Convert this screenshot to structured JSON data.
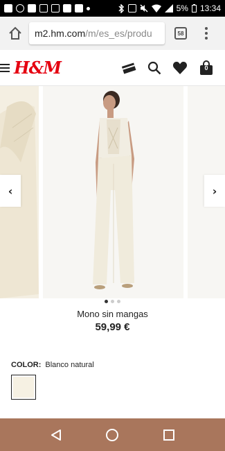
{
  "status_bar": {
    "battery_percent": "5%",
    "time": "13:34",
    "left_icons": [
      "facebook-icon",
      "whatsapp-icon",
      "app-icon",
      "check-icon",
      "mail-icon",
      "image-icon",
      "bag-notification-icon",
      "dot-icon"
    ],
    "right_icons": [
      "bluetooth-icon",
      "nfc-icon",
      "mute-icon",
      "wifi-icon",
      "signal-icon",
      "battery-icon"
    ]
  },
  "browser": {
    "url_host": "m2.hm.com",
    "url_path": "/m/es_es/produ",
    "tab_count": "58"
  },
  "header": {
    "logo": "H&M",
    "bag_count": "0",
    "icons": [
      "menu-icon",
      "card-icon",
      "search-icon",
      "heart-icon",
      "bag-icon"
    ]
  },
  "gallery": {
    "image_count": 3,
    "active_index": 0
  },
  "product": {
    "name": "Mono sin mangas",
    "price": "59,99 €"
  },
  "color": {
    "label": "COLOR:",
    "value": "Blanco natural",
    "swatch_hex": "#f6f1e3"
  },
  "colors": {
    "brand_red": "#e50010",
    "nav_bar": "#a9765c",
    "chrome_bg": "#f2f2f2"
  }
}
